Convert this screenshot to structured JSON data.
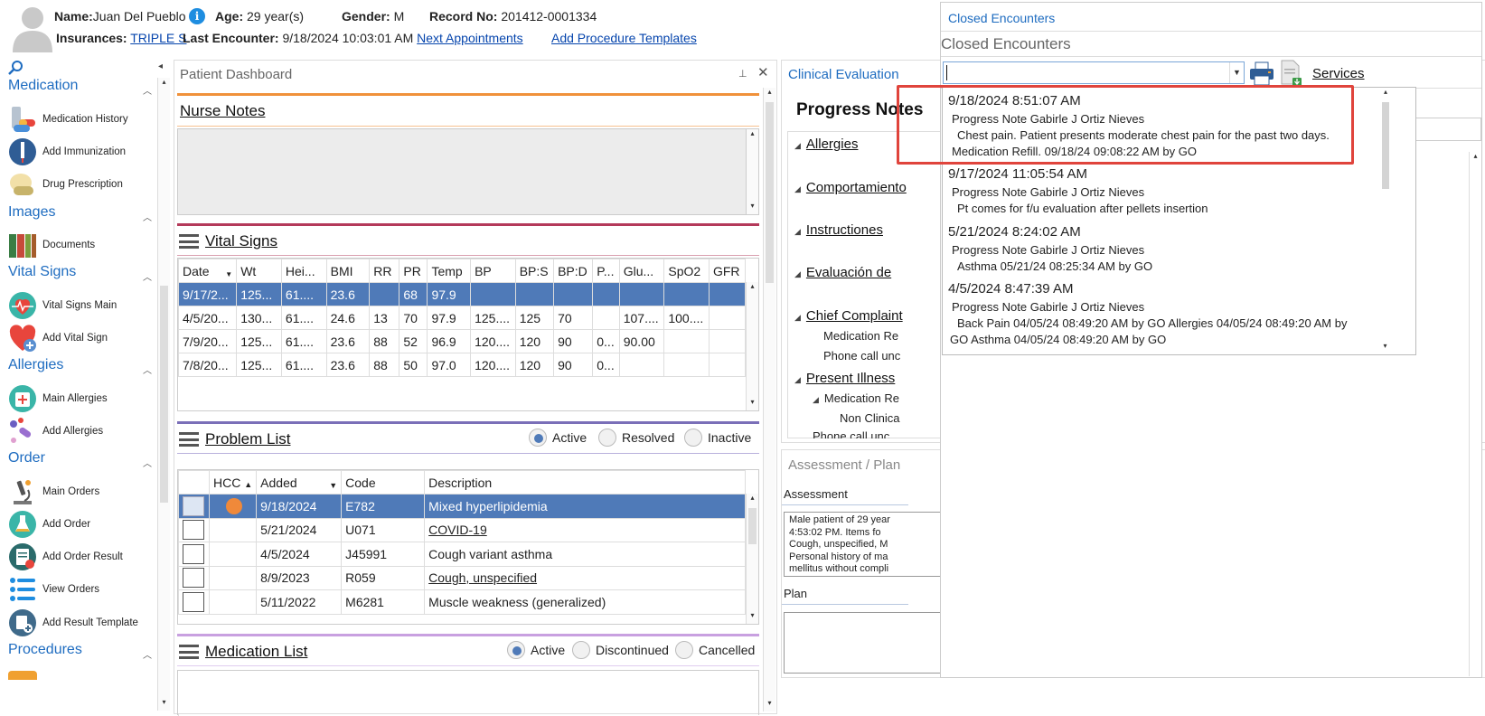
{
  "header": {
    "name_label": "Name:",
    "name_value": "Juan Del Pueblo",
    "age_label": "Age:",
    "age_value": "29 year(s)",
    "gender_label": "Gender:",
    "gender_value": "M",
    "record_label": "Record No:",
    "record_value": "201412-0001334",
    "insurances_label": "Insurances:",
    "insurance_link": "TRIPLE S",
    "last_enc_label": "Last Encounter:",
    "last_enc_value": "9/18/2024 10:03:01 AM",
    "next_appointments": "Next Appointments",
    "add_procedure_templates": "Add Procedure Templates"
  },
  "sidebar": {
    "sections": [
      {
        "title": "Medication",
        "items": [
          "Medication History",
          "Add Immunization",
          "Drug Prescription"
        ]
      },
      {
        "title": "Images",
        "items": [
          "Documents"
        ]
      },
      {
        "title": "Vital Signs",
        "items": [
          "Vital Signs Main",
          "Add Vital Sign"
        ]
      },
      {
        "title": "Allergies",
        "items": [
          "Main Allergies",
          "Add Allergies"
        ]
      },
      {
        "title": "Order",
        "items": [
          "Main Orders",
          "Add Order",
          "Add Order Result",
          "View Orders",
          "Add Result Template"
        ]
      },
      {
        "title": "Procedures",
        "items": []
      }
    ]
  },
  "dashboard": {
    "title": "Patient Dashboard",
    "nurse_notes": "Nurse Notes",
    "vital_signs": "Vital Signs",
    "vitals_columns": [
      "Date",
      "Wt",
      "Hei...",
      "BMI",
      "RR",
      "PR",
      "Temp",
      "BP",
      "BP:S",
      "BP:D",
      "P...",
      "Glu...",
      "SpO2",
      "GFR"
    ],
    "vitals_rows": [
      [
        "9/17/2...",
        "125...",
        "61....",
        "23.6",
        "",
        "68",
        "97.9",
        "",
        "",
        "",
        "",
        "",
        "",
        ""
      ],
      [
        "4/5/20...",
        "130...",
        "61....",
        "24.6",
        "13",
        "70",
        "97.9",
        "125....",
        "125",
        "70",
        "",
        "107....",
        "100....",
        ""
      ],
      [
        "7/9/20...",
        "125...",
        "61....",
        "23.6",
        "88",
        "52",
        "96.9",
        "120....",
        "120",
        "90",
        "0...",
        "90.00",
        "",
        ""
      ],
      [
        "7/8/20...",
        "125...",
        "61....",
        "23.6",
        "88",
        "50",
        "97.0",
        "120....",
        "120",
        "90",
        "0...",
        "",
        "",
        ""
      ]
    ],
    "problem_list": "Problem List",
    "problem_filters": [
      "Active",
      "Resolved",
      "Inactive"
    ],
    "problem_columns": [
      "HCC",
      "Added",
      "Code",
      "Description"
    ],
    "problem_rows": [
      {
        "added": "9/18/2024",
        "code": "E782",
        "desc": "Mixed hyperlipidemia"
      },
      {
        "added": "5/21/2024",
        "code": "U071",
        "desc": "COVID-19"
      },
      {
        "added": "4/5/2024",
        "code": "J45991",
        "desc": "Cough variant asthma"
      },
      {
        "added": "8/9/2023",
        "code": "R059",
        "desc": "Cough, unspecified"
      },
      {
        "added": "5/11/2022",
        "code": "M6281",
        "desc": "Muscle weakness (generalized)"
      }
    ],
    "medication_list": "Medication List",
    "medication_filters": [
      "Active",
      "Discontinued",
      "Cancelled"
    ]
  },
  "clinical": {
    "title": "Clinical Evaluation",
    "progress_notes": "Progress Notes",
    "items": [
      "Allergies",
      "Comportamiento",
      "Instructiones",
      "Evaluación de",
      "Chief Complaint",
      "Present Illness"
    ],
    "sub_items": [
      "Medication Re",
      "Phone call unc",
      "Medication Re",
      "Non Clinica",
      "Phone call unc"
    ],
    "assessment_plan": "Assessment / Plan",
    "assessment_label": "Assessment",
    "assessment_text": [
      "Male patient of 29 year",
      "4:53:02 PM.   Items fo",
      "Cough, unspecified, M",
      "Personal history of ma",
      "mellitus without compli"
    ],
    "plan_label": "Plan"
  },
  "closed_encounters": {
    "link": "Closed Encounters",
    "title": "Closed Encounters",
    "services": "Services",
    "encounters": [
      {
        "date": "9/18/2024 8:51:07 AM",
        "line1": "Progress Note  Gabirle J Ortiz Nieves",
        "line2": "Chest pain. Patient presents moderate chest pain for the past two days.",
        "line3": "Medication Refill.    09/18/24 09:08:22 AM by GO"
      },
      {
        "date": "9/17/2024 11:05:54 AM",
        "line1": "Progress Note  Gabirle J Ortiz Nieves",
        "line2": "Pt comes for f/u evaluation after pellets insertion",
        "line3": ""
      },
      {
        "date": "5/21/2024 8:24:02 AM",
        "line1": "Progress Note  Gabirle J Ortiz Nieves",
        "line2": "Asthma   05/21/24 08:25:34 AM by GO",
        "line3": ""
      },
      {
        "date": "4/5/2024 8:47:39 AM",
        "line1": "Progress Note  Gabirle J Ortiz Nieves",
        "line2": "Back Pain   04/05/24 08:49:20 AM by GO   Allergies   04/05/24 08:49:20 AM by",
        "line3": "GO   Asthma   04/05/24 08:49:20 AM by GO"
      }
    ],
    "highlight_color": "#e0443c"
  }
}
